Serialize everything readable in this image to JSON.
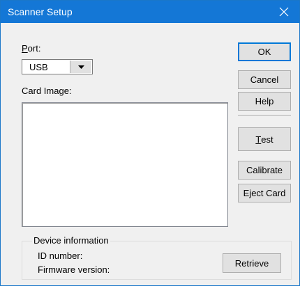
{
  "window": {
    "title": "Scanner Setup"
  },
  "port": {
    "label_mnemonic": "P",
    "label_rest": "ort:",
    "value": "USB"
  },
  "card_image": {
    "label": "Card Image:"
  },
  "buttons": {
    "ok": "OK",
    "cancel": "Cancel",
    "help": "Help",
    "test_mnemonic": "T",
    "test_rest": "est",
    "calibrate": "Calibrate",
    "eject_pre": "E",
    "eject_mnemonic": "j",
    "eject_rest": "ect Card",
    "retrieve": "Retrieve"
  },
  "device_info": {
    "title": "Device information",
    "id_label": "ID number:",
    "firmware_label": "Firmware version:"
  },
  "colors": {
    "titlebar": "#1477d6",
    "dialog_bg": "#f0f0f0",
    "default_button_border": "#0078d7"
  },
  "icons": {
    "close": "close-icon",
    "dropdown": "chevron-down-icon"
  }
}
